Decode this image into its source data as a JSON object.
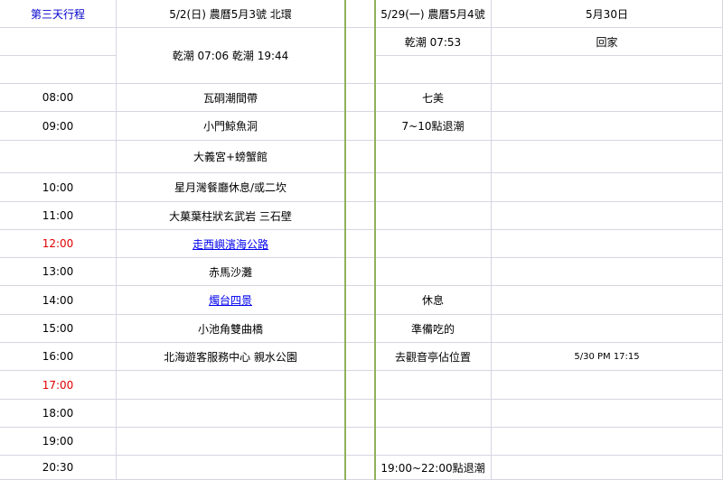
{
  "header": {
    "day_title": "第三天行程",
    "col_5_2": "5/2(日) 農曆5月3號 北環",
    "col_5_29": "5/29(一) 農曆5月4號",
    "col_5_30": "5月30日"
  },
  "tide_row": {
    "col_5_2": "乾潮  07:06  乾潮  19:44",
    "col_5_29": "乾潮  07:53",
    "col_5_30": "回家"
  },
  "rows": [
    {
      "time": "08:00",
      "c2": "瓦硐潮間帶",
      "c4": "七美",
      "c5": ""
    },
    {
      "time": "09:00",
      "c2": "小門鯨魚洞",
      "c4": "7~10點退潮",
      "c5": ""
    },
    {
      "time": "",
      "c2": "大義宮+螃蟹館",
      "c4": "",
      "c5": ""
    },
    {
      "time": "10:00",
      "c2": "星月灣餐廳休息/或二坎",
      "c4": "",
      "c5": ""
    },
    {
      "time": "11:00",
      "c2": "大菓葉柱狀玄武岩  三石壁",
      "c4": "",
      "c5": ""
    },
    {
      "time": "12:00",
      "c2": "走西嶼濱海公路",
      "c4": "",
      "c5": ""
    },
    {
      "time": "13:00",
      "c2": "赤馬沙灘",
      "c4": "",
      "c5": ""
    },
    {
      "time": "14:00",
      "c2": "燭台四景",
      "c4": "休息",
      "c5": ""
    },
    {
      "time": "15:00",
      "c2": "小池角雙曲橋",
      "c4": "準備吃的",
      "c5": ""
    },
    {
      "time": "16:00",
      "c2": "北海遊客服務中心 親水公園",
      "c4": "去觀音亭佔位置",
      "c5": "5/30 PM 17:15"
    },
    {
      "time": "17:00",
      "c2": "",
      "c4": "",
      "c5": ""
    },
    {
      "time": "18:00",
      "c2": "",
      "c4": "",
      "c5": ""
    },
    {
      "time": "19:00",
      "c2": "",
      "c4": "",
      "c5": ""
    },
    {
      "time": "20:30",
      "c2": "",
      "c4": "19:00~22:00點退潮",
      "c5": ""
    }
  ]
}
